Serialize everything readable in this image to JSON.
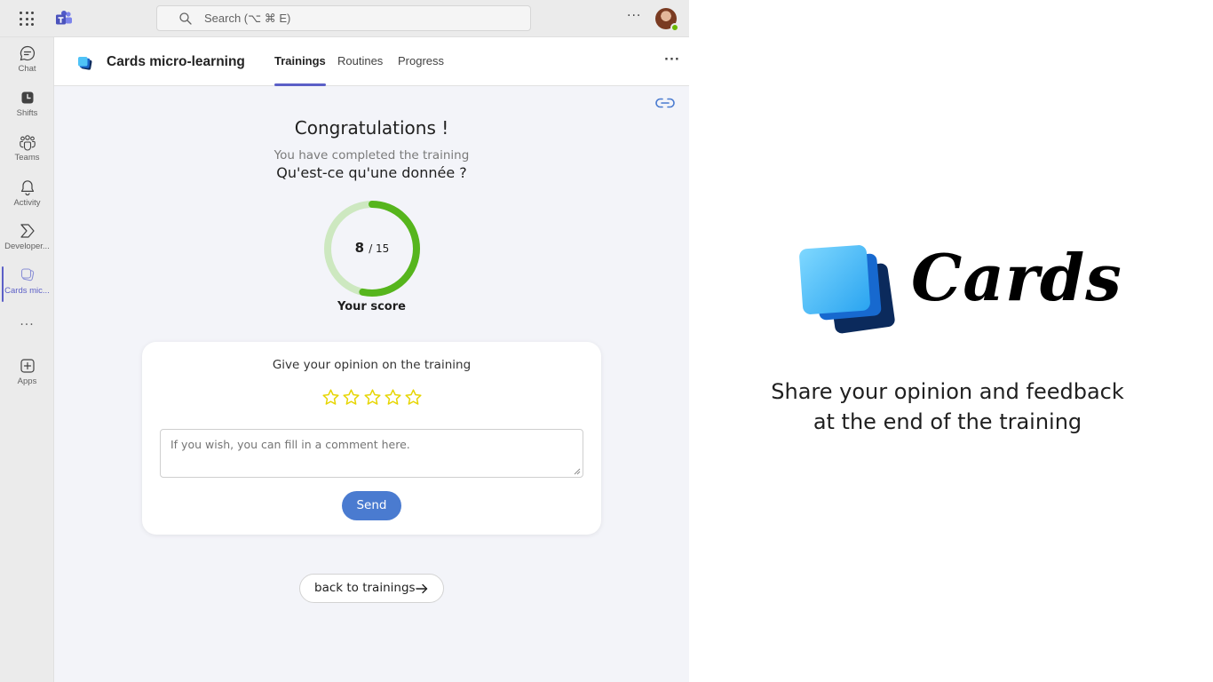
{
  "topbar": {
    "search_placeholder": "Search (⌥ ⌘ E)",
    "more_label": "···"
  },
  "rail": {
    "items": [
      {
        "label": "Chat",
        "icon": "chat-icon"
      },
      {
        "label": "Shifts",
        "icon": "shifts-icon"
      },
      {
        "label": "Teams",
        "icon": "teams-icon"
      },
      {
        "label": "Activity",
        "icon": "bell-icon"
      },
      {
        "label": "Developer...",
        "icon": "developer-portal-icon"
      },
      {
        "label": "Cards mic...",
        "icon": "cards-app-icon",
        "active": true
      },
      {
        "label": "Apps",
        "icon": "apps-add-icon"
      }
    ],
    "more_label": "···"
  },
  "app": {
    "title": "Cards micro-learning",
    "tabs": [
      {
        "label": "Trainings",
        "active": true
      },
      {
        "label": "Routines"
      },
      {
        "label": "Progress"
      }
    ],
    "more_label": "···"
  },
  "result": {
    "congrats": "Congratulations !",
    "completed_text": "You have completed the training",
    "training_name": "Qu'est-ce qu'une donnée ?",
    "score": "8",
    "score_total": "/ 15",
    "score_fraction": 0.5333,
    "score_label": "Your score"
  },
  "feedback": {
    "title": "Give your opinion on the training",
    "stars_total": 5,
    "stars_selected": 0,
    "comment_placeholder": "If you wish, you can fill in a comment here.",
    "send_label": "Send"
  },
  "back_label": "back to trainings",
  "promo": {
    "brand": "Cards",
    "tagline_line1": "Share your opinion and feedback",
    "tagline_line2": "at the end of the training"
  },
  "colors": {
    "teams_accent": "#5b5fc7",
    "ring_fg": "#56b51d",
    "ring_bg": "#cde8c0",
    "star": "#e6d500",
    "send_button": "#4a7bd0"
  }
}
